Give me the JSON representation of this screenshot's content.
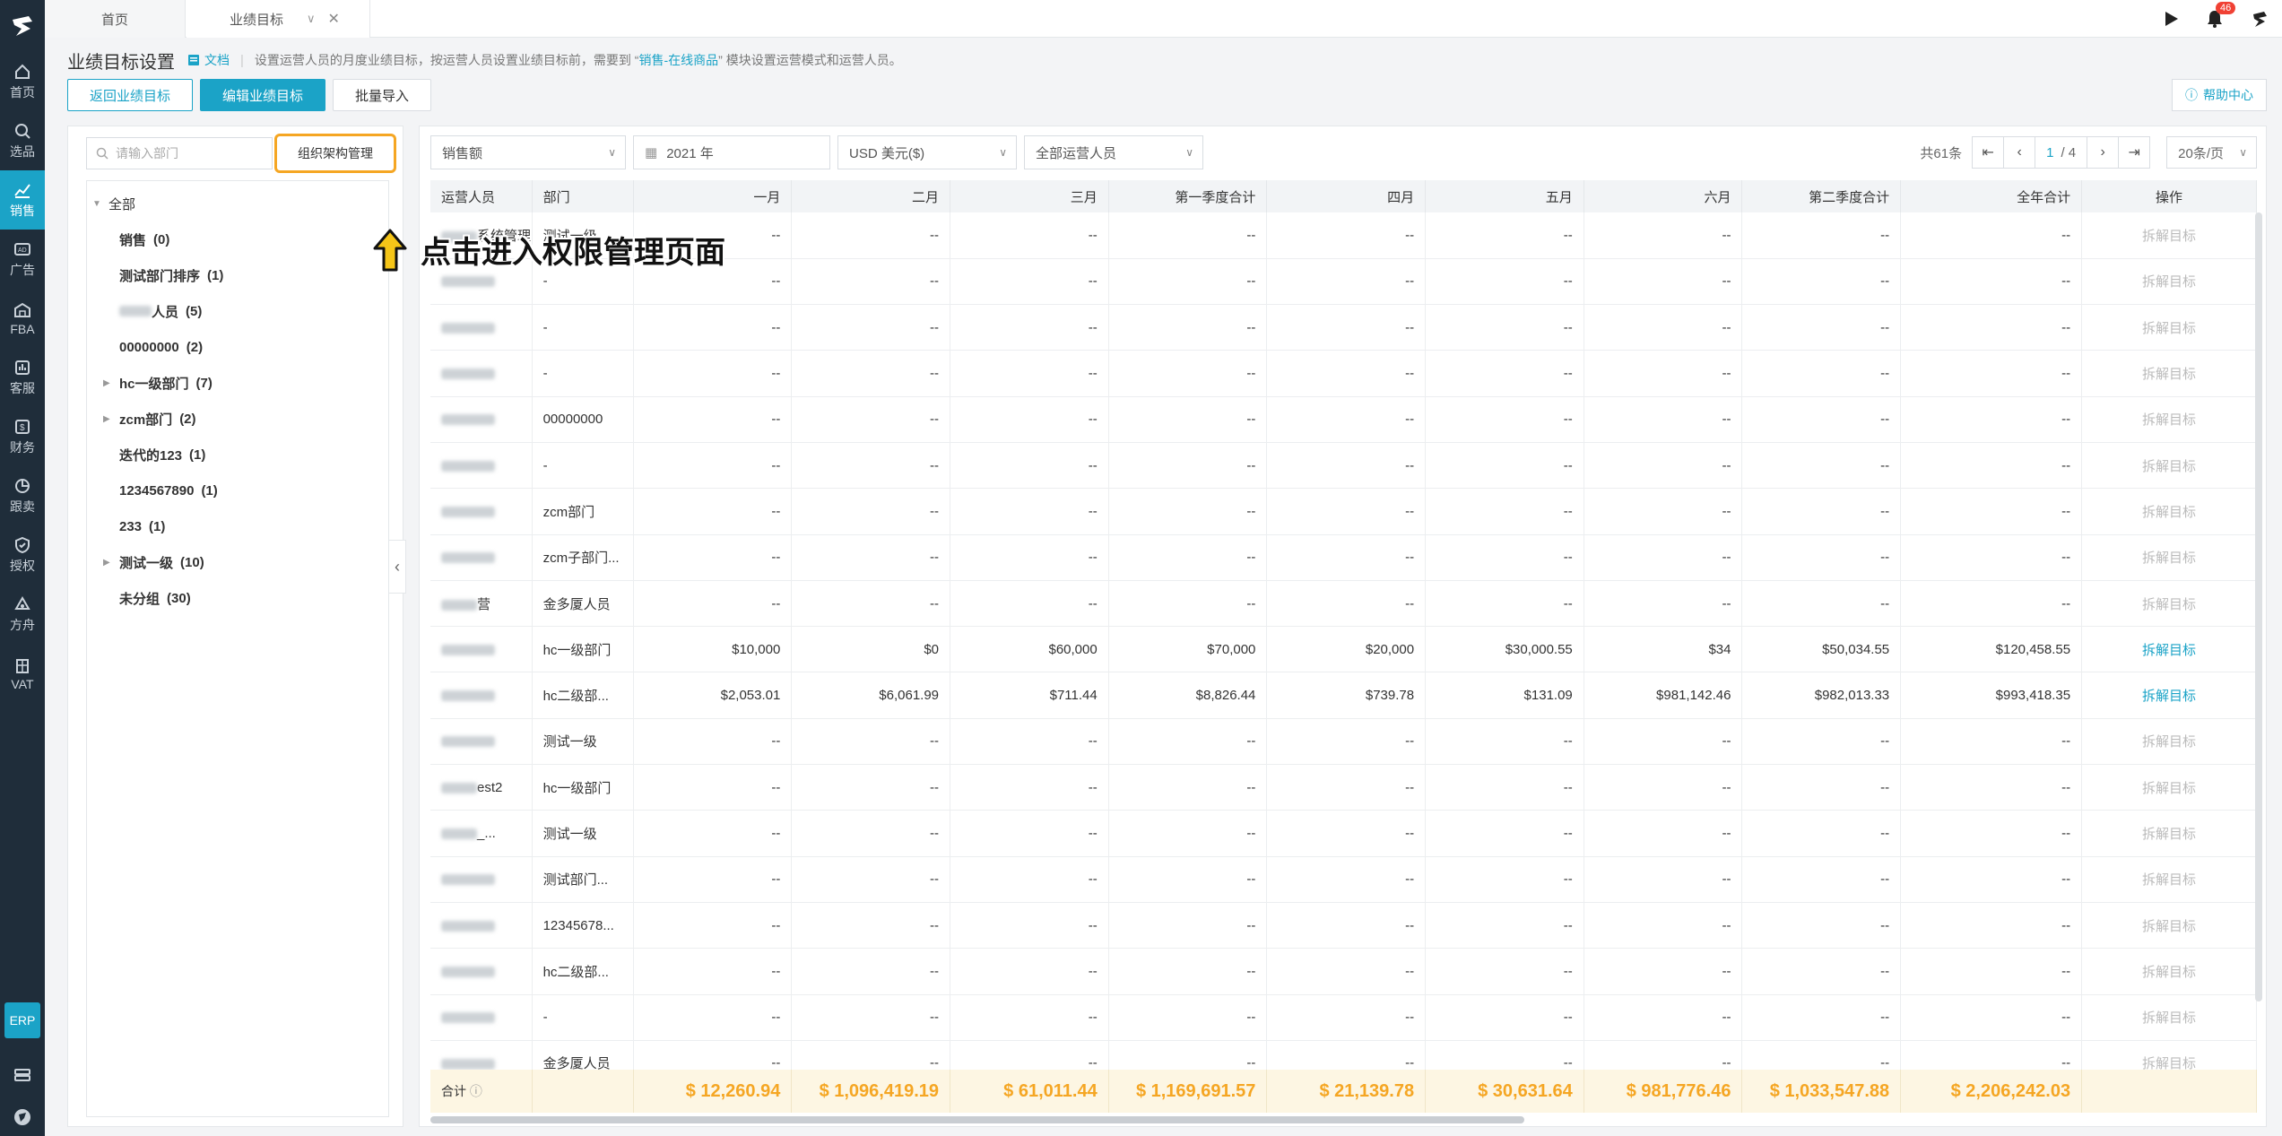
{
  "nav": {
    "items": [
      {
        "label": "首页",
        "icon": "home-icon"
      },
      {
        "label": "选品",
        "icon": "search-icon"
      },
      {
        "label": "销售",
        "icon": "chart-icon"
      },
      {
        "label": "广告",
        "icon": "ad-icon"
      },
      {
        "label": "FBA",
        "icon": "warehouse-icon"
      },
      {
        "label": "客服",
        "icon": "service-icon"
      },
      {
        "label": "财务",
        "icon": "finance-icon"
      },
      {
        "label": "跟卖",
        "icon": "pie-icon"
      },
      {
        "label": "授权",
        "icon": "shield-icon"
      },
      {
        "label": "方舟",
        "icon": "ark-icon"
      },
      {
        "label": "VAT",
        "icon": "building-icon"
      }
    ],
    "erp": "ERP"
  },
  "tabs": [
    {
      "label": "首页"
    },
    {
      "label": "业绩目标"
    }
  ],
  "notifications": {
    "count": "46"
  },
  "page": {
    "title": "业绩目标设置",
    "doc_link": "文档",
    "desc_before": "设置运营人员的月度业绩目标，按运营人员设置业绩目标前，需要到 “",
    "desc_link": "销售-在线商品",
    "desc_after": "” 模块设置运营模式和运营人员。",
    "buttons": {
      "back": "返回业绩目标",
      "edit": "编辑业绩目标",
      "import": "批量导入"
    },
    "help": "帮助中心"
  },
  "left": {
    "search_placeholder": "请输入部门",
    "org_button": "组织架构管理",
    "annotation": "点击进入权限管理页面",
    "tree": [
      {
        "label": "全部",
        "count": "",
        "level": 0,
        "expandable": true
      },
      {
        "label": "销售",
        "count": "(0)",
        "level": 1,
        "expandable": false
      },
      {
        "label": "测试部门排序",
        "count": "(1)",
        "level": 1,
        "expandable": false
      },
      {
        "label": "人员",
        "count": "(5)",
        "level": 1,
        "expandable": false,
        "blur_prefix": true
      },
      {
        "label": "00000000",
        "count": "(2)",
        "level": 1,
        "expandable": false
      },
      {
        "label": "hc一级部门",
        "count": "(7)",
        "level": 1,
        "expandable": true
      },
      {
        "label": "zcm部门",
        "count": "(2)",
        "level": 1,
        "expandable": true
      },
      {
        "label": "迭代的123",
        "count": "(1)",
        "level": 1,
        "expandable": false
      },
      {
        "label": "1234567890",
        "count": "(1)",
        "level": 1,
        "expandable": false
      },
      {
        "label": "233",
        "count": "(1)",
        "level": 1,
        "expandable": false
      },
      {
        "label": "测试一级",
        "count": "(10)",
        "level": 1,
        "expandable": true
      },
      {
        "label": "未分组",
        "count": "(30)",
        "level": 1,
        "expandable": false
      }
    ]
  },
  "filters": {
    "metric": "销售额",
    "year": "2021 年",
    "currency": "USD  美元($)",
    "operator": "全部运营人员"
  },
  "pager": {
    "total": "共61条",
    "current": "1",
    "pages": "/ 4",
    "page_size": "20条/页"
  },
  "table": {
    "columns": [
      "运营人员",
      "部门",
      "一月",
      "二月",
      "三月",
      "第一季度合计",
      "四月",
      "五月",
      "六月",
      "第二季度合计",
      "全年合计",
      "操作"
    ],
    "action_label": "拆解目标",
    "rows": [
      {
        "name": "系统管理...",
        "dept": "测试一级",
        "v": [
          "--",
          "--",
          "--",
          "--",
          "--",
          "--",
          "--",
          "--",
          "--"
        ],
        "active": false
      },
      {
        "name": "",
        "dept": "-",
        "v": [
          "--",
          "--",
          "--",
          "--",
          "--",
          "--",
          "--",
          "--",
          "--"
        ],
        "active": false
      },
      {
        "name": "",
        "dept": "-",
        "v": [
          "--",
          "--",
          "--",
          "--",
          "--",
          "--",
          "--",
          "--",
          "--"
        ],
        "active": false
      },
      {
        "name": "",
        "dept": "-",
        "v": [
          "--",
          "--",
          "--",
          "--",
          "--",
          "--",
          "--",
          "--",
          "--"
        ],
        "active": false
      },
      {
        "name": "",
        "dept": "00000000",
        "v": [
          "--",
          "--",
          "--",
          "--",
          "--",
          "--",
          "--",
          "--",
          "--"
        ],
        "active": false
      },
      {
        "name": "",
        "dept": "-",
        "v": [
          "--",
          "--",
          "--",
          "--",
          "--",
          "--",
          "--",
          "--",
          "--"
        ],
        "active": false
      },
      {
        "name": "",
        "dept": "zcm部门",
        "v": [
          "--",
          "--",
          "--",
          "--",
          "--",
          "--",
          "--",
          "--",
          "--"
        ],
        "active": false
      },
      {
        "name": "",
        "dept": "zcm子部门...",
        "v": [
          "--",
          "--",
          "--",
          "--",
          "--",
          "--",
          "--",
          "--",
          "--"
        ],
        "active": false
      },
      {
        "name": "营",
        "dept": "金多厦人员",
        "v": [
          "--",
          "--",
          "--",
          "--",
          "--",
          "--",
          "--",
          "--",
          "--"
        ],
        "active": false
      },
      {
        "name": "",
        "dept": "hc一级部门",
        "v": [
          "$10,000",
          "$0",
          "$60,000",
          "$70,000",
          "$20,000",
          "$30,000.55",
          "$34",
          "$50,034.55",
          "$120,458.55"
        ],
        "active": true
      },
      {
        "name": "",
        "dept": "hc二级部...",
        "v": [
          "$2,053.01",
          "$6,061.99",
          "$711.44",
          "$8,826.44",
          "$739.78",
          "$131.09",
          "$981,142.46",
          "$982,013.33",
          "$993,418.35"
        ],
        "active": true
      },
      {
        "name": "",
        "dept": "测试一级",
        "v": [
          "--",
          "--",
          "--",
          "--",
          "--",
          "--",
          "--",
          "--",
          "--"
        ],
        "active": false
      },
      {
        "name": "est2",
        "dept": "hc一级部门",
        "v": [
          "--",
          "--",
          "--",
          "--",
          "--",
          "--",
          "--",
          "--",
          "--"
        ],
        "active": false
      },
      {
        "name": "_...",
        "dept": "测试一级",
        "v": [
          "--",
          "--",
          "--",
          "--",
          "--",
          "--",
          "--",
          "--",
          "--"
        ],
        "active": false
      },
      {
        "name": "",
        "dept": "测试部门...",
        "v": [
          "--",
          "--",
          "--",
          "--",
          "--",
          "--",
          "--",
          "--",
          "--"
        ],
        "active": false
      },
      {
        "name": "",
        "dept": "12345678...",
        "v": [
          "--",
          "--",
          "--",
          "--",
          "--",
          "--",
          "--",
          "--",
          "--"
        ],
        "active": false
      },
      {
        "name": "",
        "dept": "hc二级部...",
        "v": [
          "--",
          "--",
          "--",
          "--",
          "--",
          "--",
          "--",
          "--",
          "--"
        ],
        "active": false
      },
      {
        "name": "",
        "dept": "-",
        "v": [
          "--",
          "--",
          "--",
          "--",
          "--",
          "--",
          "--",
          "--",
          "--"
        ],
        "active": false
      },
      {
        "name": "",
        "dept": "金多厦人员",
        "v": [
          "--",
          "--",
          "--",
          "--",
          "--",
          "--",
          "--",
          "--",
          "--"
        ],
        "active": false
      }
    ],
    "footer": {
      "label": "合计",
      "values": [
        "$ 12,260.94",
        "$ 1,096,419.19",
        "$ 61,011.44",
        "$ 1,169,691.57",
        "$ 21,139.78",
        "$ 30,631.64",
        "$ 981,776.46",
        "$ 1,033,547.88",
        "$ 2,206,242.03"
      ]
    }
  }
}
